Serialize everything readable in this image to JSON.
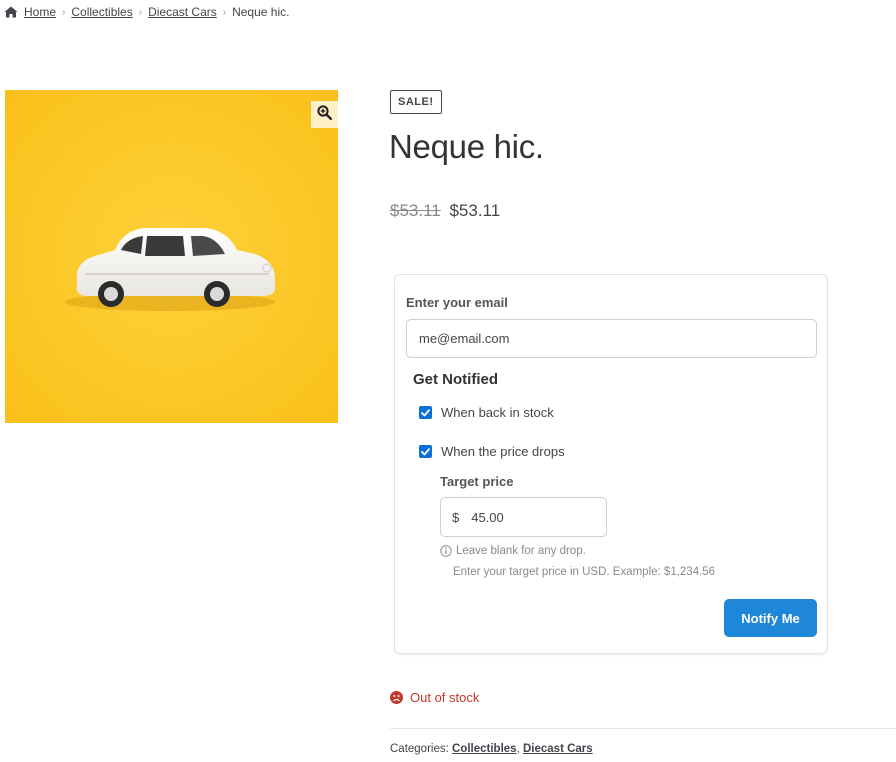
{
  "breadcrumb": {
    "home": "Home",
    "collectibles": "Collectibles",
    "diecast": "Diecast Cars",
    "current": "Neque hic."
  },
  "product": {
    "badge": "SALE!",
    "title": "Neque hic.",
    "price_old": "$53.11",
    "price_new": "$53.11",
    "image_icon": "zoom-icon"
  },
  "notify_form": {
    "email_label": "Enter your email",
    "email_value": "me@email.com",
    "heading": "Get Notified",
    "option_back_in_stock": "When back in stock",
    "option_price_drop": "When the price drops",
    "option_back_in_stock_checked": true,
    "option_price_drop_checked": true,
    "target_label": "Target price",
    "currency_symbol": "$",
    "target_value": "45.00",
    "hint_blank": "Leave blank for any drop.",
    "hint_example": "Enter your target price in USD. Example: $1,234.56",
    "submit_label": "Notify Me"
  },
  "stock": {
    "status": "Out of stock",
    "color": "#c0392b"
  },
  "categories": {
    "label": "Categories:",
    "items": [
      "Collectibles",
      "Diecast Cars"
    ],
    "separator": ","
  },
  "colors": {
    "accent": "#1e87d8",
    "image_background": "#fdc81f",
    "checkbox": "#0a6fd8"
  }
}
